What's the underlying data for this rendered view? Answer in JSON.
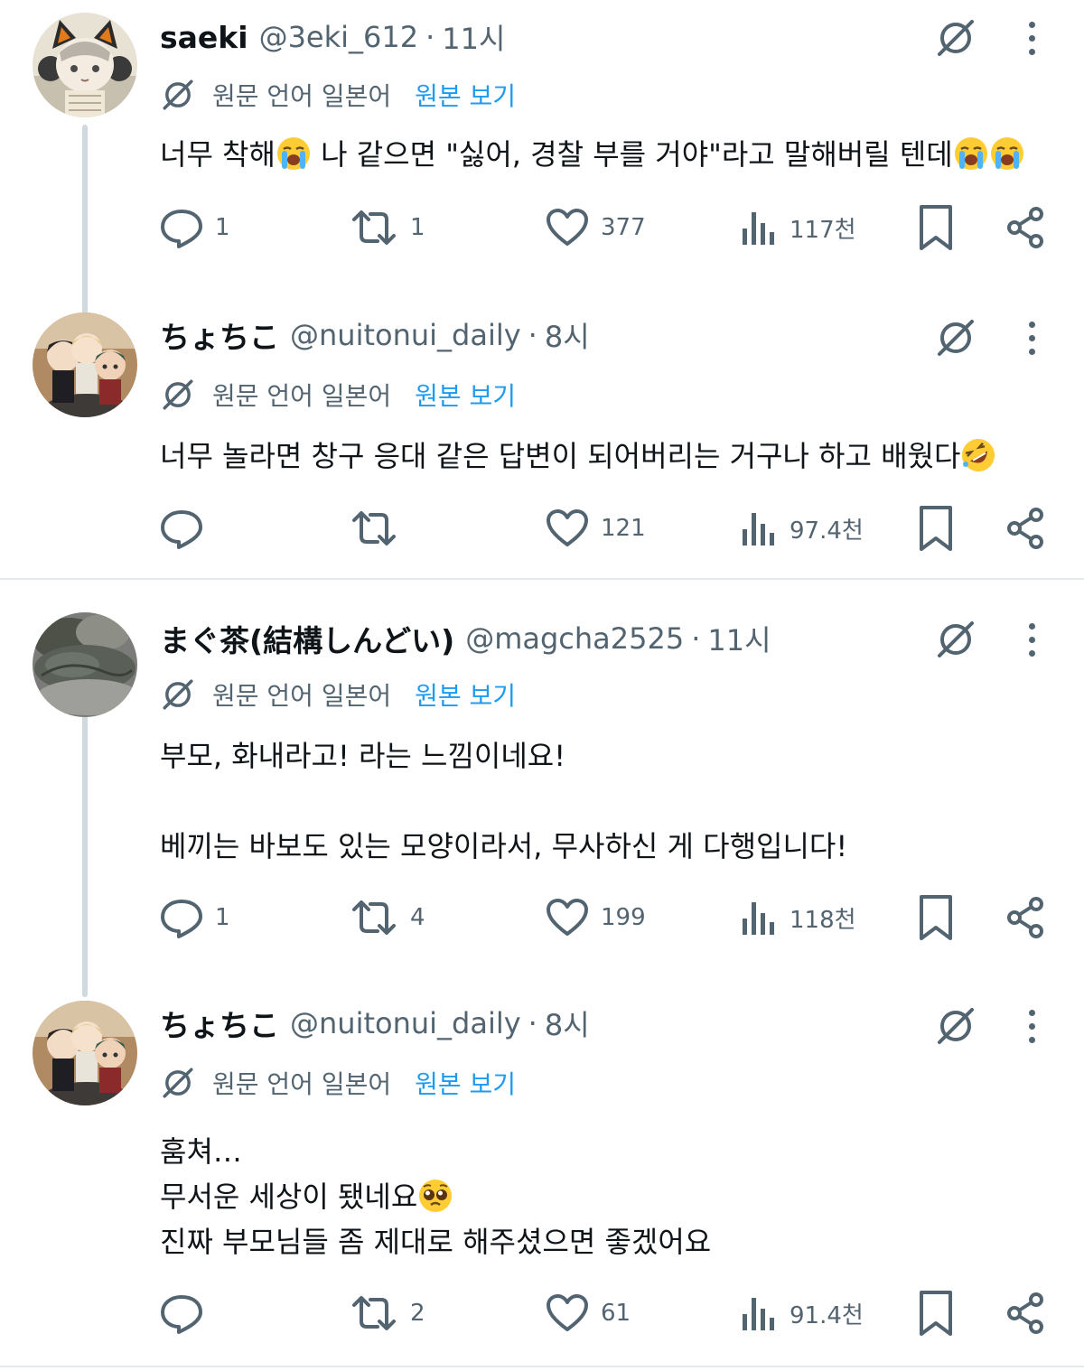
{
  "colors": {
    "text_primary": "#0f1419",
    "text_secondary": "#536471",
    "link": "#1d9bf0",
    "divider": "#e6e9ec",
    "thread_line": "#cfd9de"
  },
  "translation": {
    "source_language_label": "원문 언어 일본어",
    "show_original_label": "원본 보기"
  },
  "tweets": [
    {
      "display_name": "saeki",
      "handle": "@3eki_612",
      "separator": "·",
      "time": "11시",
      "avatar_icon": "plush-doll-cat-ears-avatar",
      "body_lines": [
        [
          "너무 착해",
          "{loudly-crying-emoji}",
          " 나 같으면 \"싫어, 경찰 부를 거야\"라고 말해버릴 텐데",
          "{loudly-crying-emoji}",
          "{loudly-crying-emoji}"
        ]
      ],
      "replies": "1",
      "retweets": "1",
      "likes": "377",
      "views": "117천"
    },
    {
      "display_name": "ちょちこ",
      "handle": "@nuitonui_daily",
      "separator": "·",
      "time": "8시",
      "avatar_icon": "plush-dolls-group-avatar",
      "body_lines": [
        [
          "너무 놀라면 창구 응대 같은 답변이 되어버리는 거구나 하고 배웠다",
          "{rolling-laughing-emoji}"
        ]
      ],
      "replies": "",
      "retweets": "",
      "likes": "121",
      "views": "97.4천"
    },
    {
      "display_name": "まぐ茶(結構しんどい)",
      "handle": "@magcha2525",
      "separator": "·",
      "time": "11시",
      "avatar_icon": "sleeping-animal-avatar",
      "body_lines": [
        [
          "부모, 화내라고! 라는 느낌이네요!"
        ],
        [
          ""
        ],
        [
          "베끼는 바보도 있는 모양이라서, 무사하신 게 다행입니다!"
        ]
      ],
      "replies": "1",
      "retweets": "4",
      "likes": "199",
      "views": "118천"
    },
    {
      "display_name": "ちょちこ",
      "handle": "@nuitonui_daily",
      "separator": "·",
      "time": "8시",
      "avatar_icon": "plush-dolls-group-avatar",
      "body_lines": [
        [
          "훔쳐…"
        ],
        [
          "무서운 세상이 됐네요",
          "{pleading-face-emoji}"
        ],
        [
          "진짜 부모님들 좀 제대로 해주셨으면 좋겠어요"
        ]
      ],
      "replies": "",
      "retweets": "2",
      "likes": "61",
      "views": "91.4천"
    }
  ]
}
